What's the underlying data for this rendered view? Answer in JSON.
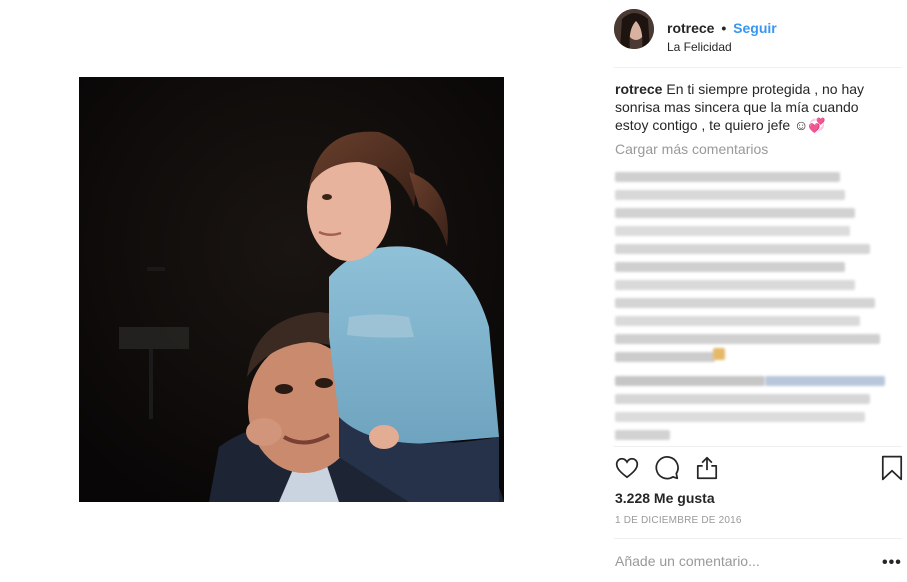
{
  "post": {
    "username": "rotrece",
    "separator": "•",
    "follow_label": "Seguir",
    "location": "La Felicidad",
    "caption_user": "rotrece",
    "caption_text": " En ti siempre protegida , no hay sonrisa mas sincera que la mía cuando estoy contigo , te quiero jefe ☺💞",
    "load_more_label": "Cargar más comentarios",
    "likes": "3.228 Me gusta",
    "date": "1 DE DICIEMBRE DE 2016",
    "comment_placeholder": "Añade un comentario...",
    "more_options": "•••"
  },
  "icons": {
    "like": "heart-icon",
    "comment": "comment-bubble-icon",
    "share": "share-icon",
    "save": "bookmark-icon"
  },
  "colors": {
    "follow": "#3897f0",
    "muted": "#999999",
    "text": "#262626"
  }
}
